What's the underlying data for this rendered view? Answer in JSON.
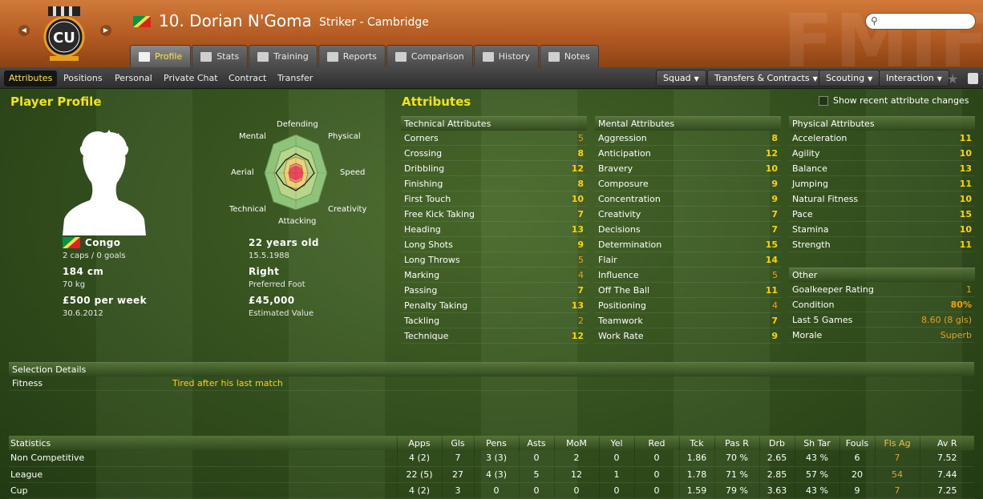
{
  "header": {
    "player_name": "10. Dorian N'Goma",
    "subtitle": "Striker - Cambridge",
    "club_badge_text": "CU",
    "watermark": "FMIF"
  },
  "tabs": [
    {
      "label": "Profile",
      "icon": "profile-icon",
      "active": true
    },
    {
      "label": "Stats",
      "icon": "stats-icon"
    },
    {
      "label": "Training",
      "icon": "training-icon"
    },
    {
      "label": "Reports",
      "icon": "reports-icon"
    },
    {
      "label": "Comparison",
      "icon": "comparison-icon"
    },
    {
      "label": "History",
      "icon": "history-icon"
    },
    {
      "label": "Notes",
      "icon": "notes-icon"
    }
  ],
  "subnav": {
    "items": [
      "Attributes",
      "Positions",
      "Personal",
      "Private Chat",
      "Contract",
      "Transfer"
    ],
    "menus": [
      "Squad",
      "Transfers & Contracts",
      "Scouting",
      "Interaction"
    ]
  },
  "profile": {
    "title": "Player Profile",
    "nationality": "Congo",
    "caps": "2 caps / 0 goals",
    "height": "184 cm",
    "weight": "70 kg",
    "wage": "£500 per week",
    "contract_end": "30.6.2012",
    "age": "22 years old",
    "dob": "15.5.1988",
    "preferred_foot": "Right",
    "preferred_foot_label": "Preferred Foot",
    "value": "£45,000",
    "value_label": "Estimated Value"
  },
  "radar": {
    "labels": [
      "Defending",
      "Physical",
      "Speed",
      "Creativity",
      "Attacking",
      "Technical",
      "Aerial",
      "Mental"
    ]
  },
  "attributes": {
    "title": "Attributes",
    "recent_toggle": "Show recent attribute changes",
    "technical": {
      "title": "Technical Attributes",
      "rows": [
        {
          "name": "Corners",
          "value": "5"
        },
        {
          "name": "Crossing",
          "value": "8"
        },
        {
          "name": "Dribbling",
          "value": "12"
        },
        {
          "name": "Finishing",
          "value": "8"
        },
        {
          "name": "First Touch",
          "value": "10"
        },
        {
          "name": "Free Kick Taking",
          "value": "7"
        },
        {
          "name": "Heading",
          "value": "13"
        },
        {
          "name": "Long Shots",
          "value": "9"
        },
        {
          "name": "Long Throws",
          "value": "5"
        },
        {
          "name": "Marking",
          "value": "4"
        },
        {
          "name": "Passing",
          "value": "7"
        },
        {
          "name": "Penalty Taking",
          "value": "13"
        },
        {
          "name": "Tackling",
          "value": "2"
        },
        {
          "name": "Technique",
          "value": "12"
        }
      ]
    },
    "mental": {
      "title": "Mental Attributes",
      "rows": [
        {
          "name": "Aggression",
          "value": "8"
        },
        {
          "name": "Anticipation",
          "value": "12"
        },
        {
          "name": "Bravery",
          "value": "10"
        },
        {
          "name": "Composure",
          "value": "9"
        },
        {
          "name": "Concentration",
          "value": "9"
        },
        {
          "name": "Creativity",
          "value": "7"
        },
        {
          "name": "Decisions",
          "value": "7"
        },
        {
          "name": "Determination",
          "value": "15"
        },
        {
          "name": "Flair",
          "value": "14"
        },
        {
          "name": "Influence",
          "value": "5"
        },
        {
          "name": "Off The Ball",
          "value": "11"
        },
        {
          "name": "Positioning",
          "value": "4"
        },
        {
          "name": "Teamwork",
          "value": "7"
        },
        {
          "name": "Work Rate",
          "value": "9"
        }
      ]
    },
    "physical": {
      "title": "Physical Attributes",
      "rows": [
        {
          "name": "Acceleration",
          "value": "11"
        },
        {
          "name": "Agility",
          "value": "10"
        },
        {
          "name": "Balance",
          "value": "13"
        },
        {
          "name": "Jumping",
          "value": "11"
        },
        {
          "name": "Natural Fitness",
          "value": "10"
        },
        {
          "name": "Pace",
          "value": "15"
        },
        {
          "name": "Stamina",
          "value": "10"
        },
        {
          "name": "Strength",
          "value": "11"
        }
      ]
    },
    "other": {
      "title": "Other",
      "rows": [
        {
          "name": "Goalkeeper Rating",
          "value": "1"
        },
        {
          "name": "Condition",
          "value": "80%"
        },
        {
          "name": "Last 5 Games",
          "value": "8.60 (8 gls)"
        },
        {
          "name": "Morale",
          "value": "Superb"
        }
      ]
    }
  },
  "selection": {
    "title": "Selection Details",
    "label": "Fitness",
    "value": "Tired after his last match"
  },
  "stats": {
    "headers": [
      "Statistics",
      "Apps",
      "Gls",
      "Pens",
      "Asts",
      "MoM",
      "Yel",
      "Red",
      "Tck",
      "Pas R",
      "Drb",
      "Sh Tar",
      "Fouls",
      "Fls Ag",
      "Av R"
    ],
    "rows": [
      [
        "Non Competitive",
        "4 (2)",
        "7",
        "3 (3)",
        "0",
        "2",
        "0",
        "0",
        "1.86",
        "70 %",
        "2.65",
        "43 %",
        "6",
        "7",
        "7.52"
      ],
      [
        "League",
        "22 (5)",
        "27",
        "4 (3)",
        "5",
        "12",
        "1",
        "0",
        "1.78",
        "71 %",
        "2.85",
        "57 %",
        "20",
        "54",
        "7.44"
      ],
      [
        "Cup",
        "4 (2)",
        "3",
        "0",
        "0",
        "0",
        "0",
        "0",
        "1.59",
        "79 %",
        "3.63",
        "43 %",
        "9",
        "7",
        "7.25"
      ]
    ]
  },
  "colors": {
    "accent_yellow": "#f1e21d",
    "header_orange": "#c26a2c",
    "value_yellow": "#ffd400"
  }
}
